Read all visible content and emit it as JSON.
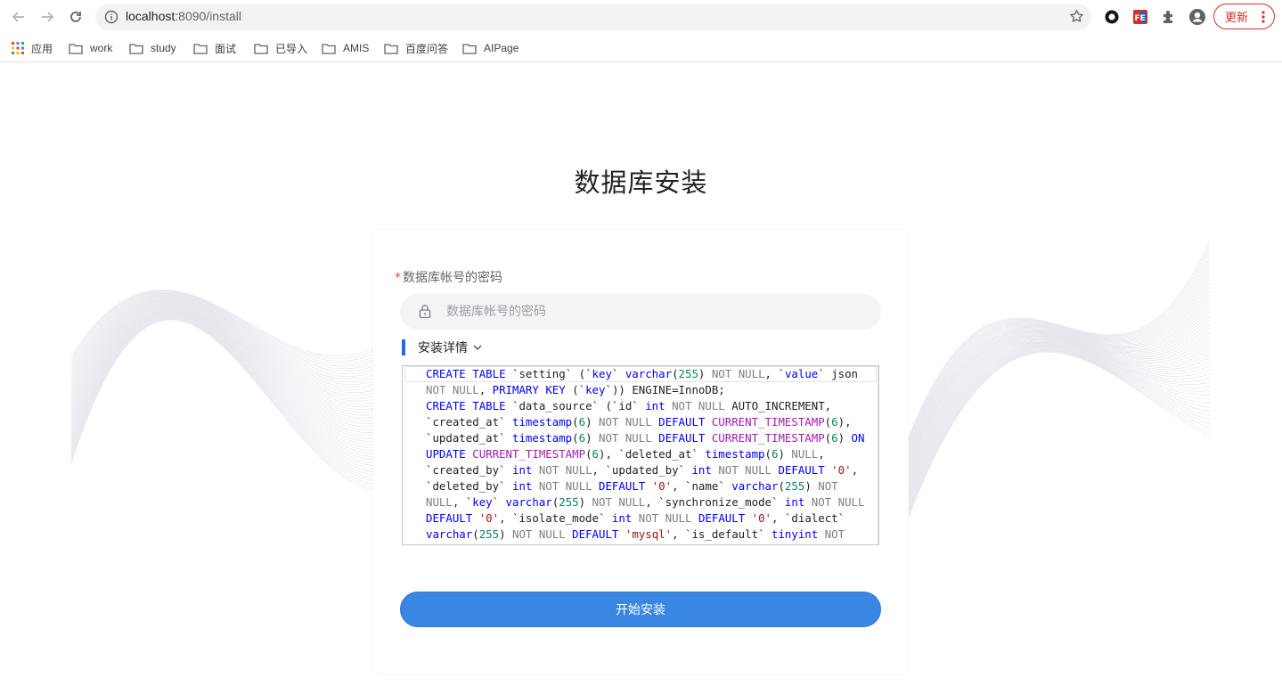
{
  "browser": {
    "url_host": "localhost",
    "url_rest": ":8090/install",
    "update_label": "更新",
    "bookmarks": [
      {
        "label": "应用",
        "icon": "apps-grid-icon"
      },
      {
        "label": "work",
        "icon": "folder-icon"
      },
      {
        "label": "study",
        "icon": "folder-icon"
      },
      {
        "label": "面试",
        "icon": "folder-icon"
      },
      {
        "label": "已导入",
        "icon": "folder-icon"
      },
      {
        "label": "AMIS",
        "icon": "folder-icon"
      },
      {
        "label": "百度问答",
        "icon": "folder-icon"
      },
      {
        "label": "AIPage",
        "icon": "folder-icon"
      }
    ]
  },
  "page": {
    "title": "数据库安装",
    "password_field": {
      "required_mark": "*",
      "label": "数据库帐号的密码",
      "placeholder": "数据库帐号的密码",
      "value": ""
    },
    "details_toggle": "安装详情",
    "submit_label": "开始安装",
    "colors": {
      "accent": "#3a86e3",
      "required": "#e84c3d",
      "bar": "#2468f2"
    }
  }
}
